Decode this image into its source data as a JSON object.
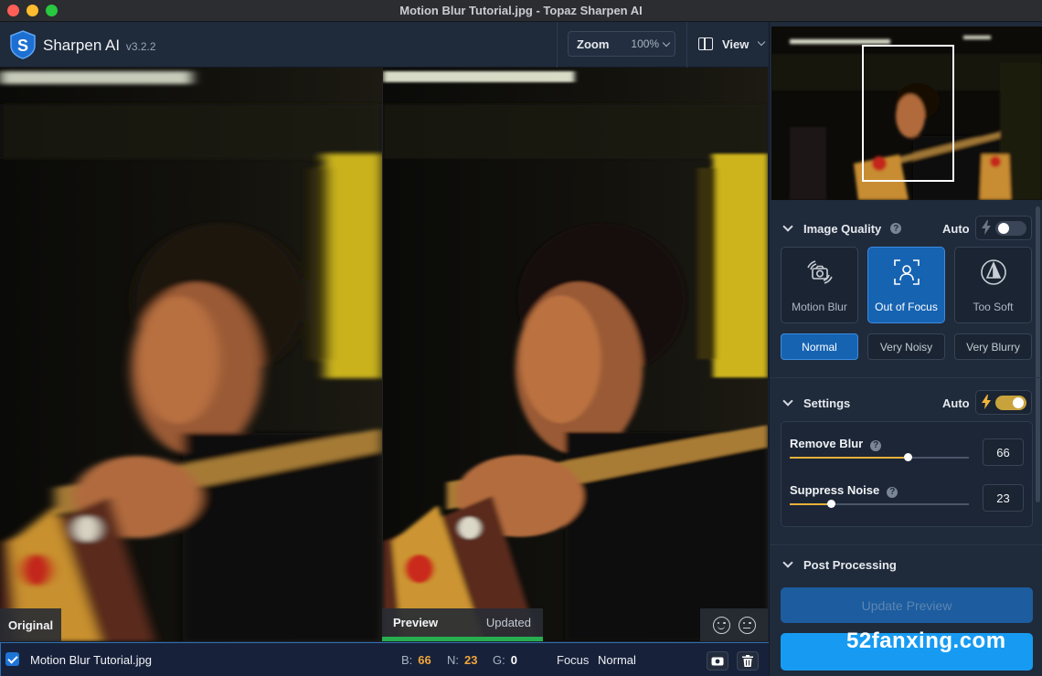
{
  "window": {
    "title": "Motion Blur Tutorial.jpg - Topaz Sharpen AI"
  },
  "header": {
    "app_name": "Sharpen AI",
    "version": "v3.2.2",
    "zoom_label": "Zoom",
    "zoom_value": "100%",
    "view_label": "View"
  },
  "viewer": {
    "original_label": "Original",
    "preview_label": "Preview",
    "preview_status": "Updated"
  },
  "filebar": {
    "checked": true,
    "filename": "Motion Blur Tutorial.jpg",
    "blur_label": "B:",
    "blur_value": "66",
    "noise_label": "N:",
    "noise_value": "23",
    "grain_label": "G:",
    "grain_value": "0",
    "focus_label": "Focus",
    "focus_value": "Normal"
  },
  "image_quality": {
    "title": "Image Quality",
    "help": "?",
    "auto_label": "Auto",
    "auto_on": false,
    "modes": [
      {
        "label": "Motion Blur",
        "icon": "motion-blur-camera-icon",
        "active": false
      },
      {
        "label": "Out of Focus",
        "icon": "out-of-focus-person-icon",
        "active": true
      },
      {
        "label": "Too Soft",
        "icon": "too-soft-prism-icon",
        "active": false
      }
    ],
    "levels": [
      {
        "label": "Normal",
        "active": true
      },
      {
        "label": "Very Noisy",
        "active": false
      },
      {
        "label": "Very Blurry",
        "active": false
      }
    ]
  },
  "settings": {
    "title": "Settings",
    "auto_label": "Auto",
    "auto_on": true,
    "remove_blur": {
      "label": "Remove Blur",
      "help": "?",
      "value": "66",
      "fraction": 0.66
    },
    "suppress_noise": {
      "label": "Suppress Noise",
      "help": "?",
      "value": "23",
      "fraction": 0.23
    }
  },
  "post_processing": {
    "title": "Post Processing"
  },
  "actions": {
    "update_preview": "Update Preview"
  },
  "watermark": "52fanxing.com",
  "colors": {
    "accent": "#1663b2",
    "slider": "#e8b13a",
    "save": "#179bf2",
    "preview_bar": "#27ae4f"
  }
}
